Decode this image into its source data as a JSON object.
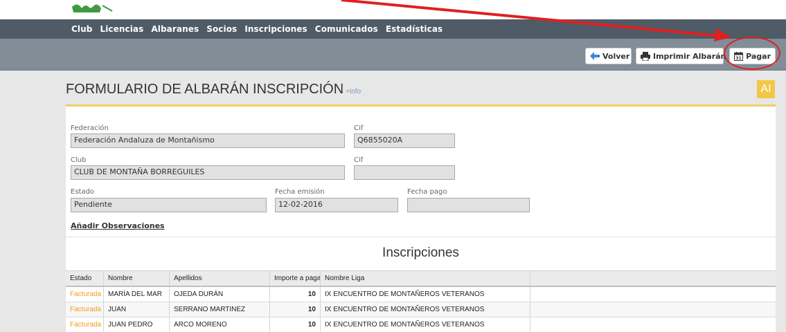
{
  "nav": {
    "items": [
      "Club",
      "Licencias",
      "Albaranes",
      "Socios",
      "Inscripciones",
      "Comunicados",
      "Estadísticas"
    ]
  },
  "toolbar": {
    "volver_label": "Volver",
    "imprimir_label": "Imprimir Albarán",
    "pagar_label": "Pagar"
  },
  "page": {
    "title": "FORMULARIO DE ALBARÁN INSCRIPCIÓN",
    "info_link": "+info",
    "badge": "AI"
  },
  "form": {
    "federacion_label": "Federación",
    "federacion_value": "Federación Andaluza de Montañismo",
    "cif1_label": "Cif",
    "cif1_value": "Q6855020A",
    "club_label": "Club",
    "club_value": "CLUB DE MONTAÑA BORREGUILES",
    "cif2_label": "Cif",
    "cif2_value": "",
    "estado_label": "Estado",
    "estado_value": "Pendiente",
    "fecha_emision_label": "Fecha emisión",
    "fecha_emision_value": "12-02-2016",
    "fecha_pago_label": "Fecha pago",
    "fecha_pago_value": "",
    "observaciones_link": "Añadir Observaciones"
  },
  "inscripciones": {
    "title": "Inscripciones",
    "columns": [
      "Estado",
      "Nombre",
      "Apellidos",
      "Importe a pagar",
      "Nombre Liga"
    ],
    "rows": [
      {
        "estado": "Facturada",
        "nombre": "MARÍA DEL MAR",
        "apellidos": "OJEDA DURÁN",
        "importe": "10",
        "liga": "IX ENCUENTRO DE MONTAÑEROS VETERANOS"
      },
      {
        "estado": "Facturada",
        "nombre": "JUAN",
        "apellidos": "SERRANO MARTINEZ",
        "importe": "10",
        "liga": "IX ENCUENTRO DE MONTAÑEROS VETERANOS"
      },
      {
        "estado": "Facturada",
        "nombre": "JUAN PEDRO",
        "apellidos": "ARCO MORENO",
        "importe": "10",
        "liga": "IX ENCUENTRO DE MONTAÑEROS VETERANOS"
      }
    ]
  },
  "colors": {
    "nav_bg": "#4f5b66",
    "toolbar_bg": "#828d97",
    "accent_yellow": "#f3c746",
    "estado_orange": "#f39a1e",
    "annotation_red": "#e02020"
  },
  "icons": {
    "volver": "arrow-left-icon",
    "imprimir": "printer-icon",
    "pagar": "calendar-icon"
  }
}
